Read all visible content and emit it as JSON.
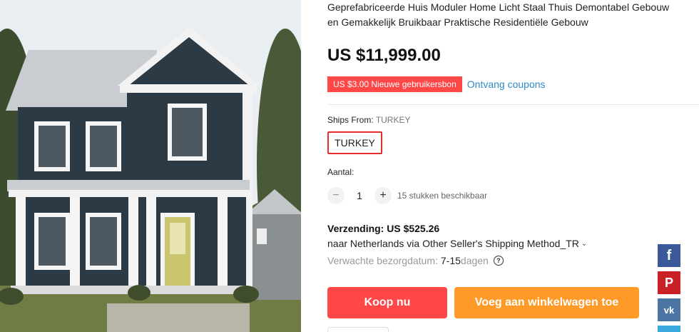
{
  "product": {
    "title_line1": "Geprefabriceerde Huis Moduler Home Licht Staal Thuis Demontabel Gebouw",
    "title_line2": "en Gemakkelijk Bruikbaar Praktische Residentiële Gebouw",
    "price": "US $11,999.00"
  },
  "coupon": {
    "badge": "US $3.00 Nieuwe gebruikersbon",
    "link": "Ontvang coupons"
  },
  "ships": {
    "label": "Ships From:",
    "value": "TURKEY",
    "option": "TURKEY"
  },
  "quantity": {
    "label": "Aantal:",
    "value": "1",
    "minus": "−",
    "plus": "+",
    "available": "15 stukken beschikbaar"
  },
  "shipping": {
    "cost": "Verzending: US $525.26",
    "destination": "naar Netherlands via Other Seller's Shipping Method_TR",
    "delivery_label": "Verwachte bezorgdatum:",
    "delivery_value": "7-15",
    "delivery_unit": "dagen"
  },
  "actions": {
    "buy": "Koop nu",
    "cart": "Voeg aan winkelwagen toe"
  },
  "social": {
    "facebook": "f",
    "pinterest": "P",
    "vk": "vk"
  },
  "colors": {
    "accent_red": "#ff4747",
    "accent_orange": "#ff9a28",
    "link_blue": "#2e8bc4"
  },
  "icons": [
    "facebook-icon",
    "pinterest-icon",
    "vk-icon",
    "twitter-icon",
    "help-circle-icon",
    "chevron-down-icon"
  ]
}
